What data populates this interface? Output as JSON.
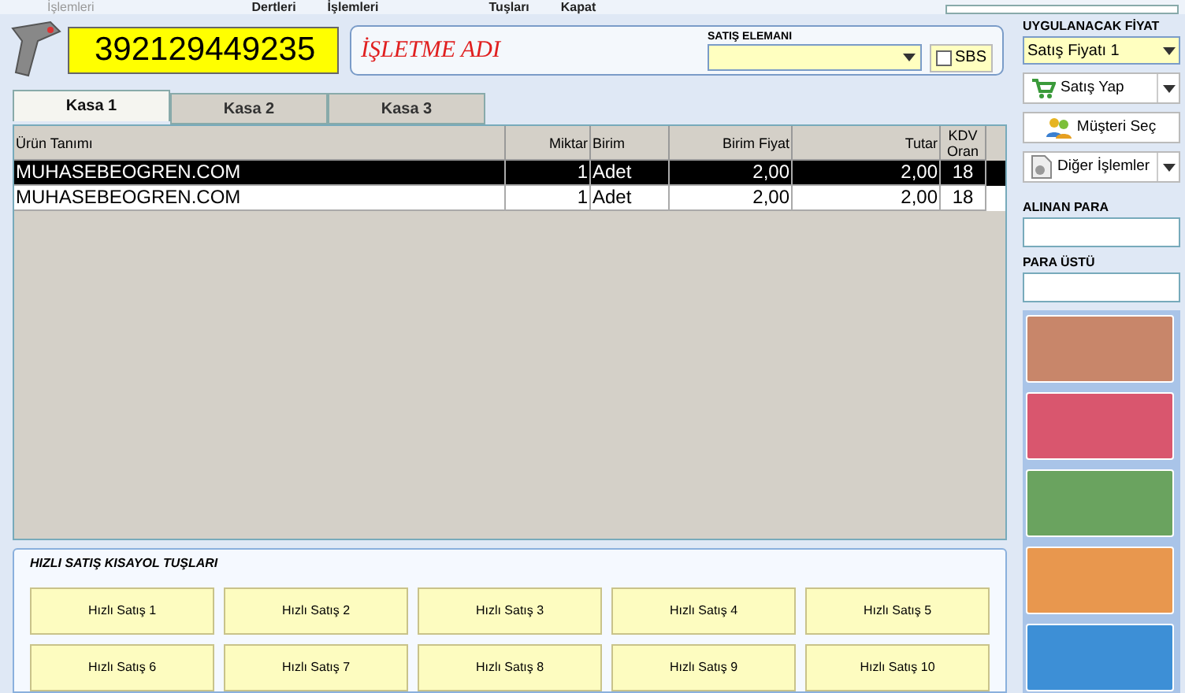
{
  "menu_bar": [
    {
      "label": "İşlemleri",
      "disabled": true
    },
    {
      "label": "Dertleri",
      "disabled": false
    },
    {
      "label": "İşlemleri",
      "disabled": false
    },
    {
      "label": "Tuşları",
      "disabled": false
    },
    {
      "label": "Kapat",
      "disabled": false
    }
  ],
  "barcode_input": {
    "value": "392129449235"
  },
  "business_name": "İŞLETME ADI",
  "sales_person": {
    "label": "SATIŞ ELEMANI",
    "sbs_label": "SBS",
    "sbs_checked": false
  },
  "tabs": [
    {
      "label": "Kasa 1",
      "selected": true
    },
    {
      "label": "Kasa 2",
      "selected": false
    },
    {
      "label": "Kasa 3",
      "selected": false
    }
  ],
  "table": {
    "columns": [
      "Ürün Tanımı",
      "Miktar",
      "Birim",
      "Birim Fiyat",
      "Tutar",
      "KDV Oran"
    ],
    "rows": [
      {
        "cells": [
          "MUHASEBEOGREN.COM",
          "1",
          "Adet",
          "2,00",
          "2,00",
          "18"
        ],
        "selected": true
      },
      {
        "cells": [
          "MUHASEBEOGREN.COM",
          "1",
          "Adet",
          "2,00",
          "2,00",
          "18"
        ],
        "selected": false
      }
    ]
  },
  "quick_sale": {
    "title": "HIZLI SATIŞ KISAYOL TUŞLARI",
    "buttons": [
      "Hızlı Satış 1",
      "Hızlı Satış 2",
      "Hızlı Satış 3",
      "Hızlı Satış 4",
      "Hızlı Satış 5",
      "Hızlı Satış 6",
      "Hızlı Satış 7",
      "Hızlı Satış 8",
      "Hızlı Satış 9",
      "Hızlı Satış 10"
    ]
  },
  "side_panel": {
    "price_label": "UYGULANACAK FİYAT",
    "price_value": "Satış Fiyatı 1",
    "actions": [
      {
        "label": "Satış Yap",
        "kind": "cart",
        "dropdown": true
      },
      {
        "label": "Müşteri Seç",
        "kind": "people",
        "dropdown": false
      },
      {
        "label": "Diğer İşlemler",
        "kind": "doc",
        "dropdown": true
      }
    ],
    "received_label": "ALINAN PARA",
    "change_label": "PARA ÜSTÜ",
    "banknotes": [
      {
        "color": "#c8866a"
      },
      {
        "color": "#d9566e"
      },
      {
        "color": "#6aa35f"
      },
      {
        "color": "#e8974e"
      },
      {
        "color": "#3d8fd6"
      }
    ]
  }
}
